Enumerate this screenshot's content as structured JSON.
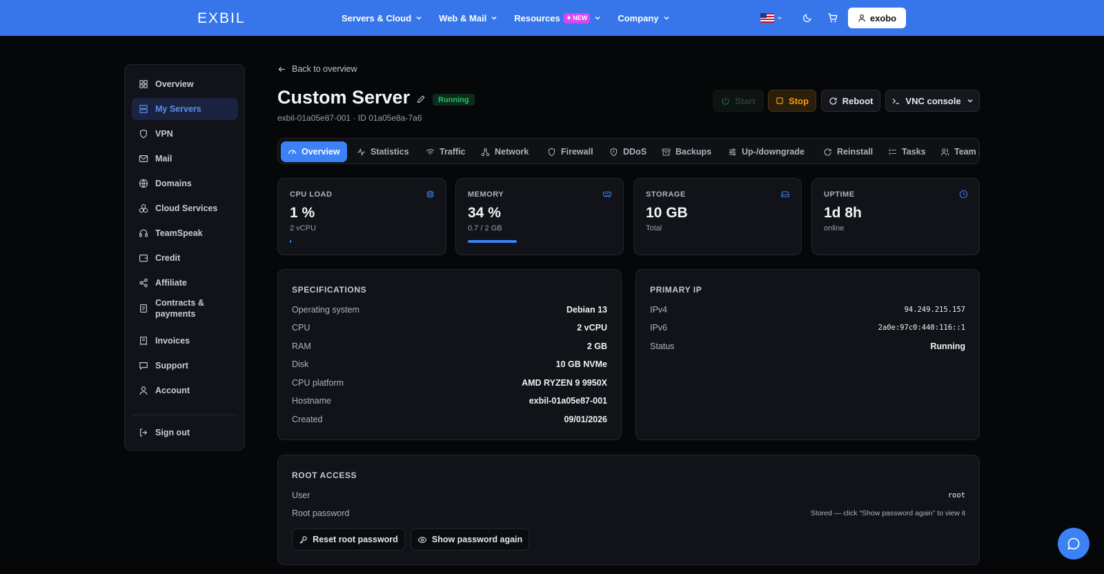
{
  "header": {
    "logo": "EXBIL",
    "nav": [
      {
        "label": "Servers & Cloud"
      },
      {
        "label": "Web & Mail"
      },
      {
        "label": "Resources",
        "badge": "NEW"
      },
      {
        "label": "Company"
      }
    ],
    "user_label": "exobo"
  },
  "sidebar": {
    "items": [
      {
        "label": "Overview",
        "icon": "grid-icon"
      },
      {
        "label": "My Servers",
        "icon": "server-icon",
        "active": true
      },
      {
        "label": "VPN",
        "icon": "shield-icon"
      },
      {
        "label": "Mail",
        "icon": "mail-icon"
      },
      {
        "label": "Domains",
        "icon": "globe-icon"
      },
      {
        "label": "Cloud Services",
        "icon": "cloud-services-icon"
      },
      {
        "label": "TeamSpeak",
        "icon": "headset-icon"
      },
      {
        "label": "Credit",
        "icon": "wallet-icon"
      },
      {
        "label": "Affiliate",
        "icon": "share-icon"
      },
      {
        "label": "Contracts & payments",
        "icon": "contract-icon"
      },
      {
        "label": "Invoices",
        "icon": "invoice-icon"
      },
      {
        "label": "Support",
        "icon": "chat-bubble-icon"
      },
      {
        "label": "Account",
        "icon": "user-icon"
      }
    ],
    "signout_label": "Sign out"
  },
  "back_label": "Back to overview",
  "server": {
    "title": "Custom Server",
    "status": "Running",
    "subtitle": "exbil-01a05e87-001 · ID 01a05e8a-7a6"
  },
  "actions": {
    "start": "Start",
    "stop": "Stop",
    "reboot": "Reboot",
    "vnc": "VNC console"
  },
  "tabs": [
    {
      "label": "Overview",
      "icon": "gauge-icon",
      "active": true
    },
    {
      "label": "Statistics",
      "icon": "activity-icon"
    },
    {
      "label": "Traffic",
      "icon": "wifi-icon"
    },
    {
      "label": "Network",
      "icon": "network-icon"
    },
    {
      "label": "Firewall",
      "icon": "shield-icon"
    },
    {
      "label": "DDoS",
      "icon": "shield-alert-icon"
    },
    {
      "label": "Backups",
      "icon": "archive-icon"
    },
    {
      "label": "Up-/downgrade",
      "icon": "sliders-icon"
    },
    {
      "label": "Reinstall",
      "icon": "refresh-icon"
    },
    {
      "label": "Tasks",
      "icon": "list-check-icon"
    },
    {
      "label": "Team access",
      "icon": "users-icon"
    }
  ],
  "stats": [
    {
      "label": "CPU LOAD",
      "value": "1 %",
      "sub": "2 vCPU",
      "bar": 0.01,
      "icon": "cpu-icon"
    },
    {
      "label": "MEMORY",
      "value": "34 %",
      "sub": "0.7 / 2 GB",
      "bar": 0.34,
      "icon": "memory-icon"
    },
    {
      "label": "STORAGE",
      "value": "10 GB",
      "sub": "Total",
      "icon": "hard-drive-icon"
    },
    {
      "label": "UPTIME",
      "value": "1d 8h",
      "sub": "online",
      "icon": "clock-icon"
    }
  ],
  "specs": {
    "title": "SPECIFICATIONS",
    "rows": [
      {
        "k": "Operating system",
        "v": "Debian 13"
      },
      {
        "k": "CPU",
        "v": "2 vCPU"
      },
      {
        "k": "RAM",
        "v": "2 GB"
      },
      {
        "k": "Disk",
        "v": "10 GB NVMe"
      },
      {
        "k": "CPU platform",
        "v": "AMD RYZEN 9 9950X"
      },
      {
        "k": "Hostname",
        "v": "exbil-01a05e87-001"
      },
      {
        "k": "Created",
        "v": "09/01/2026"
      }
    ]
  },
  "primary_ip": {
    "title": "PRIMARY IP",
    "rows": [
      {
        "k": "IPv4",
        "v": "94.249.215.157"
      },
      {
        "k": "IPv6",
        "v": "2a0e:97c0:440:116::1"
      },
      {
        "k": "Status",
        "v": "Running"
      }
    ]
  },
  "root": {
    "title": "ROOT ACCESS",
    "user_label": "User",
    "user_value": "root",
    "pw_label": "Root password",
    "pw_note": "Stored — click “Show password again” to view it",
    "reset_label": "Reset root password",
    "show_label": "Show password again"
  },
  "colors": {
    "accent": "#3b82f6",
    "header": "#3676ea",
    "running": "#22c55e",
    "stop": "#f59e0b"
  }
}
